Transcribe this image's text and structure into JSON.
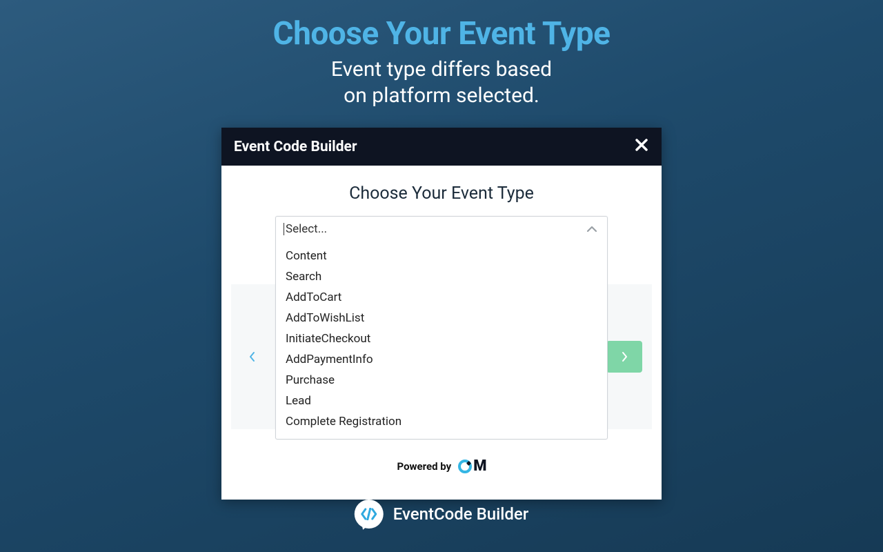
{
  "hero": {
    "title": "Choose Your Event Type",
    "subtitle_line1": "Event type differs based",
    "subtitle_line2": "on platform selected."
  },
  "modal": {
    "title": "Event Code Builder",
    "step_title": "Choose Your Event Type",
    "select": {
      "placeholder": "Select...",
      "options": [
        "Content",
        "Search",
        "AddToCart",
        "AddToWishList",
        "InitiateCheckout",
        "AddPaymentInfo",
        "Purchase",
        "Lead",
        "Complete Registration"
      ]
    },
    "powered_by_label": "Powered by",
    "powered_by_brand": "OM"
  },
  "footer": {
    "brand": "EventCode Builder"
  }
}
